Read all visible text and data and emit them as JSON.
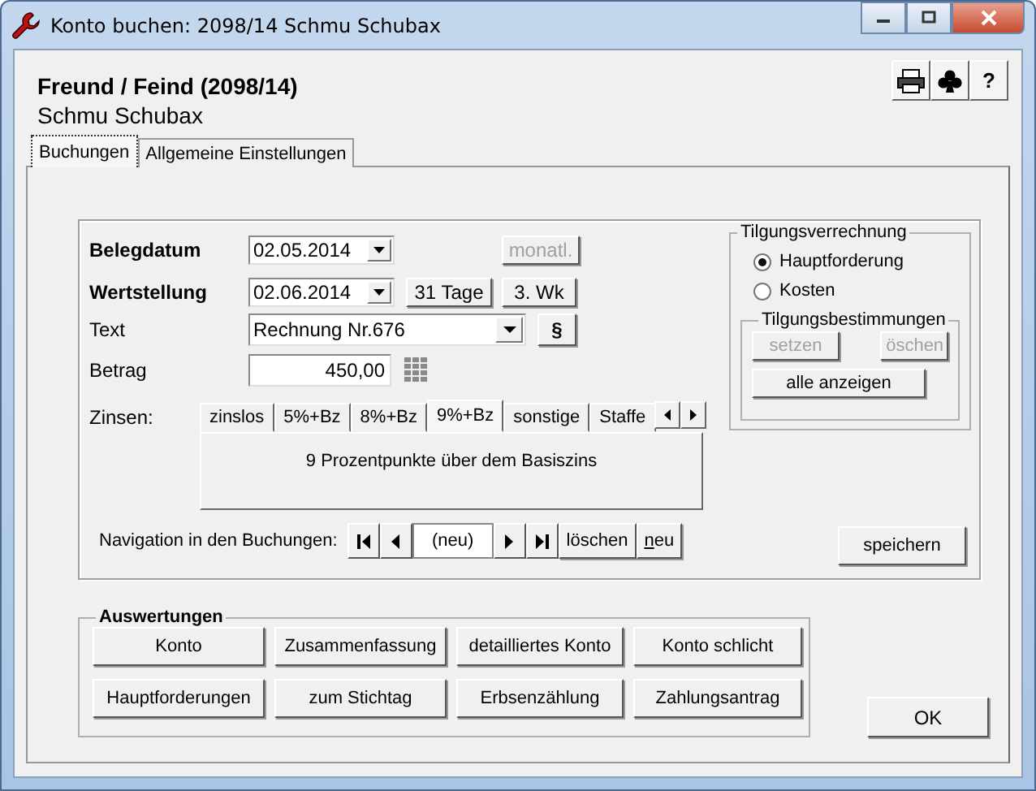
{
  "window": {
    "title": "Konto buchen: 2098/14 Schmu Schubax"
  },
  "header": {
    "title": "Freund / Feind (2098/14)",
    "subtitle": "Schmu Schubax",
    "help_label": "?"
  },
  "tabs": [
    {
      "label": "Buchungen",
      "selected": true
    },
    {
      "label": "Allgemeine Einstellungen",
      "selected": false
    }
  ],
  "form": {
    "belegdatum": {
      "label": "Belegdatum",
      "value": "02.05.2014"
    },
    "monatl_button": {
      "label": "monatl.",
      "disabled": true
    },
    "wertstellung": {
      "label": "Wertstellung",
      "value": "02.06.2014"
    },
    "wertstellung_buttons": [
      {
        "label": "31 Tage",
        "disabled": false
      },
      {
        "label": "3. Wk",
        "disabled": false
      }
    ],
    "text": {
      "label": "Text",
      "value": "Rechnung Nr.676"
    },
    "paragraph_button": "§",
    "betrag": {
      "label": "Betrag",
      "value": "450,00"
    }
  },
  "zinsen": {
    "label": "Zinsen:",
    "tabs": [
      {
        "label": "zinslos",
        "selected": false
      },
      {
        "label": "5%+Bz",
        "selected": false
      },
      {
        "label": "8%+Bz",
        "selected": false
      },
      {
        "label": "9%+Bz",
        "selected": true
      },
      {
        "label": "sonstige",
        "selected": false
      },
      {
        "label": "Staffe",
        "selected": false
      }
    ],
    "description": "9 Prozentpunkte über dem Basiszins"
  },
  "navigation": {
    "label": "Navigation in den Buchungen:",
    "position": "(neu)",
    "delete_label": "löschen",
    "new_label": "neu"
  },
  "tilgungsverrechnung": {
    "title": "Tilgungsverrechnung",
    "options": [
      {
        "label": "Hauptforderung",
        "selected": true
      },
      {
        "label": "Kosten",
        "selected": false
      }
    ],
    "bestimmungen": {
      "title": "Tilgungsbestimmungen",
      "buttons": [
        {
          "label": "setzen",
          "disabled": true
        },
        {
          "label": "öschen",
          "disabled": true
        }
      ],
      "show_all": "alle anzeigen"
    }
  },
  "save_label": "speichern",
  "auswertungen": {
    "title": "Auswertungen",
    "buttons": [
      "Konto",
      "Zusammenfassung",
      "detailliertes Konto",
      "Konto schlicht",
      "Hauptforderungen",
      "zum Stichtag",
      "Erbsenzählung",
      "Zahlungsantrag"
    ]
  },
  "ok_label": "OK"
}
